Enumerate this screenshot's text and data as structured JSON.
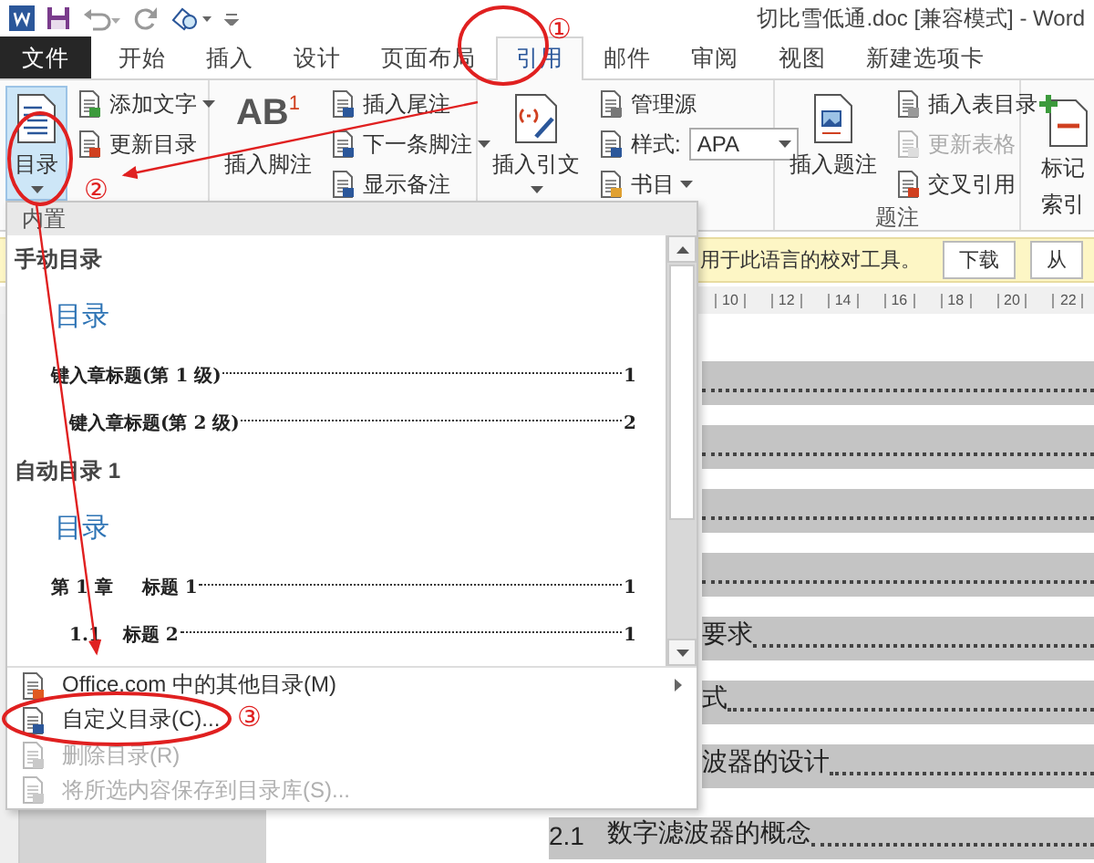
{
  "title_bar": {
    "title": "切比雪低通.doc [兼容模式] - Word"
  },
  "tabs": [
    {
      "label": "文件",
      "kind": "file",
      "selected": false
    },
    {
      "label": "开始",
      "kind": "tab",
      "selected": false
    },
    {
      "label": "插入",
      "kind": "tab",
      "selected": false
    },
    {
      "label": "设计",
      "kind": "tab",
      "selected": false
    },
    {
      "label": "页面布局",
      "kind": "tab",
      "selected": false
    },
    {
      "label": "引用",
      "kind": "tab",
      "selected": true
    },
    {
      "label": "邮件",
      "kind": "tab",
      "selected": false
    },
    {
      "label": "审阅",
      "kind": "tab",
      "selected": false
    },
    {
      "label": "视图",
      "kind": "tab",
      "selected": false
    },
    {
      "label": "新建选项卡",
      "kind": "tab",
      "selected": false
    }
  ],
  "ribbon": {
    "groups": [
      {
        "large": [
          {
            "label": "目录",
            "dropdown": true,
            "expanded": true
          }
        ],
        "small": [
          {
            "label": "添加文字",
            "dropdown": true,
            "disabled": false
          },
          {
            "label": "更新目录",
            "dropdown": false,
            "disabled": false
          }
        ]
      },
      {
        "large": [
          {
            "label": "插入脚注",
            "glyph": "AB",
            "glyph_sup": "1",
            "dropdown": false,
            "expanded": false
          }
        ],
        "small": [
          {
            "label": "插入尾注",
            "dropdown": false,
            "disabled": false
          },
          {
            "label": "下一条脚注",
            "dropdown": true,
            "disabled": false
          },
          {
            "label": "显示备注",
            "dropdown": false,
            "disabled": false
          }
        ]
      },
      {
        "large": [
          {
            "label": "插入引文",
            "dropdown": true,
            "expanded": false
          }
        ],
        "small": [
          {
            "label": "管理源",
            "dropdown": false,
            "disabled": false
          },
          {
            "label": "样式:",
            "combo_value": "APA"
          },
          {
            "label": "书目",
            "dropdown": true,
            "disabled": false
          }
        ]
      },
      {
        "label": "题注",
        "large": [
          {
            "label": "插入题注",
            "dropdown": false,
            "expanded": false
          }
        ],
        "small": [
          {
            "label": "插入表目录",
            "dropdown": false,
            "disabled": false
          },
          {
            "label": "更新表格",
            "dropdown": false,
            "disabled": true
          },
          {
            "label": "交叉引用",
            "dropdown": false,
            "disabled": false
          }
        ]
      },
      {
        "large": [
          {
            "label": "标记",
            "label_2": "索引",
            "dropdown": false,
            "expanded": false
          }
        ]
      }
    ]
  },
  "toc_gallery": {
    "header": "内置",
    "entries": [
      {
        "title": "手动目录",
        "heading": "目录",
        "lines": [
          {
            "kind": "level1",
            "text": "键入章标题(第 1 级)",
            "page": "1"
          },
          {
            "kind": "level2",
            "text": "键入章标题(第 2 级)",
            "page": "2"
          }
        ]
      },
      {
        "title": "自动目录 1",
        "heading": "目录",
        "lines": [
          {
            "kind": "level1",
            "number": "第 1 章",
            "text": "标题 1",
            "page": "1"
          },
          {
            "kind": "level2",
            "number": "1.1",
            "text": "标题 2",
            "page": "1"
          }
        ]
      }
    ],
    "menu": [
      {
        "label": "Office.com 中的其他目录(M)",
        "disabled": false,
        "submenu": true
      },
      {
        "label": "自定义目录(C)...",
        "disabled": false,
        "submenu": false
      },
      {
        "label": "删除目录(R)",
        "disabled": true,
        "submenu": false
      },
      {
        "label": "将所选内容保存到目录库(S)...",
        "disabled": true,
        "submenu": false
      }
    ]
  },
  "message_bar": {
    "text": "用于此语言的校对工具。",
    "buttons": [
      "下载",
      "从"
    ]
  },
  "ruler": [
    "10",
    "12",
    "14",
    "16",
    "18",
    "20",
    "22"
  ],
  "document_lines": [
    {
      "kind": "leader"
    },
    {
      "kind": "leader"
    },
    {
      "kind": "leader"
    },
    {
      "kind": "leader"
    },
    {
      "kind": "entry",
      "text": "要求"
    },
    {
      "kind": "entry",
      "text": "式"
    },
    {
      "kind": "entry",
      "text": "波器的设计"
    },
    {
      "kind": "numbered",
      "number": "2.1",
      "text": "数字滤波器的概念"
    }
  ],
  "annotations": [
    {
      "label": "①"
    },
    {
      "label": "②"
    },
    {
      "label": "③"
    }
  ]
}
